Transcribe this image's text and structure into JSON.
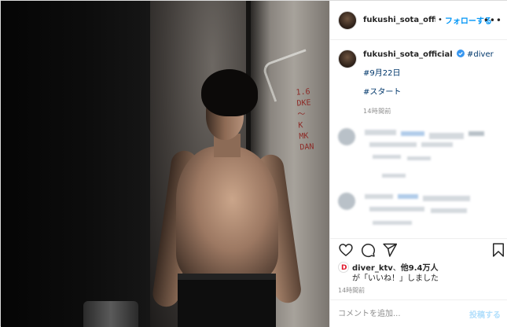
{
  "header": {
    "username": "fukushi_sota_official",
    "separator": "•",
    "follow_label": "フォローする",
    "more_label": "•••"
  },
  "caption": {
    "username": "fukushi_sota_official",
    "verified_icon": "verified-badge-icon",
    "hashtags": [
      "#diver",
      "#9月22日",
      "#スタート"
    ],
    "time": "14時間前"
  },
  "actions": {
    "icons": [
      "heart-icon",
      "comment-icon",
      "share-icon",
      "bookmark-icon"
    ]
  },
  "likes": {
    "avatar_letter": "D",
    "liker": "diver_ktv",
    "connector": "、",
    "others": "他9.4万人",
    "line2": "が「いいね！」しました"
  },
  "likes_time": "14時間前",
  "comment": {
    "placeholder": "コメントを追加...",
    "post_label": "投稿する"
  },
  "colors": {
    "link": "#0095f6",
    "hashtag": "#00376b",
    "muted": "#8e8e8e",
    "post_disabled": "#b2dffc"
  }
}
